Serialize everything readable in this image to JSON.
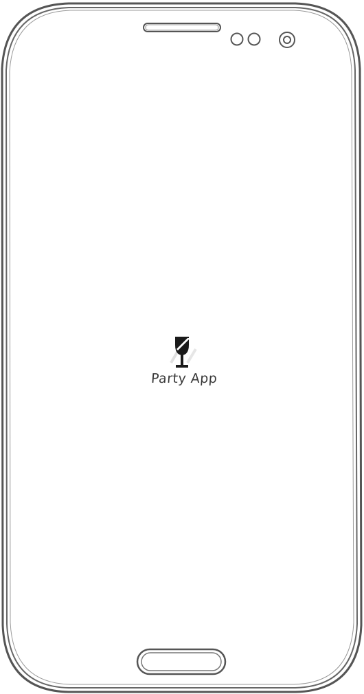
{
  "splash": {
    "app_name": "Party App",
    "icon": "wine-glass-icon"
  },
  "colors": {
    "frame_stroke": "#555555",
    "icon_fill": "#1a1a1a",
    "text": "#3a3a3a",
    "background": "#ffffff"
  }
}
